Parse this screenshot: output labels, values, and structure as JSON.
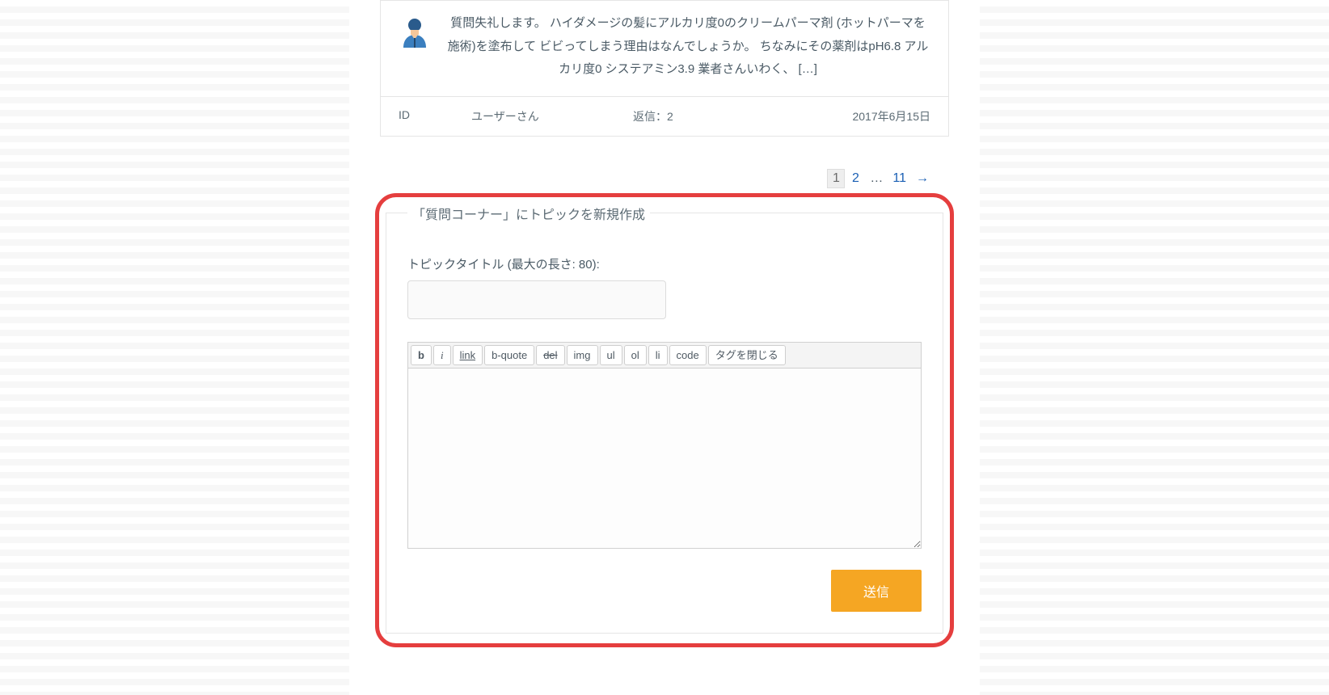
{
  "post": {
    "body": "質問失礼します。 ハイダメージの髪にアルカリ度0のクリームパーマ剤 (ホットパーマを施術)を塗布して ビビってしまう理由はなんでしょうか。 ちなみにその薬剤はpH6.8 アルカリ度0 システアミン3.9 業者さんいわく、 […]",
    "meta": {
      "id_label": "ID",
      "user": "ユーザーさん",
      "replies": "返信：2",
      "date": "2017年6月15日"
    }
  },
  "pagination": {
    "items": [
      {
        "label": "1",
        "type": "current"
      },
      {
        "label": "2",
        "type": "link"
      },
      {
        "label": "…",
        "type": "dots"
      },
      {
        "label": "11",
        "type": "link"
      },
      {
        "label": "→",
        "type": "link"
      }
    ]
  },
  "form": {
    "legend": "「質問コーナー」にトピックを新規作成",
    "title_label": "トピックタイトル (最大の長さ: 80):",
    "title_value": "",
    "toolbar": {
      "b": "b",
      "i": "i",
      "link": "link",
      "bquote": "b-quote",
      "del": "del",
      "img": "img",
      "ul": "ul",
      "ol": "ol",
      "li": "li",
      "code": "code",
      "close": "タグを閉じる"
    },
    "body_value": "",
    "submit": "送信"
  }
}
